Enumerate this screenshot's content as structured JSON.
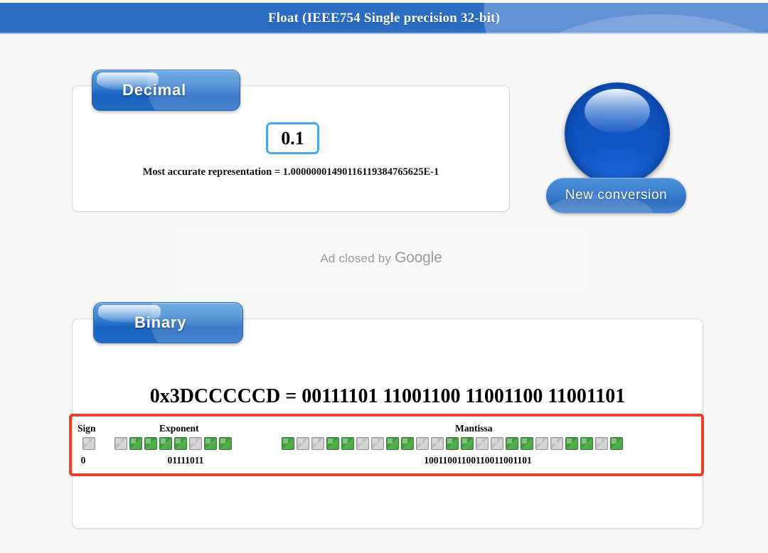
{
  "header": {
    "title": "Float (IEEE754 Single precision 32-bit)"
  },
  "decimal_panel": {
    "tab_label": "Decimal",
    "input_value": "0.1",
    "input_placeholder": "",
    "accurate_representation": "Most accurate representation = 1.00000001490116119384765625E-1"
  },
  "new_conversion_button": {
    "label": "New conversion"
  },
  "ad": {
    "text": "Ad closed by ",
    "brand": "Google"
  },
  "binary_panel": {
    "tab_label": "Binary",
    "hex_line": "0x3DCCCCCD = 00111101 11001100 11001100 11001101",
    "hex_value": "0x3DCCCCCD",
    "binary_groups": [
      "00111101",
      "11001100",
      "11001100",
      "11001101"
    ],
    "fields": {
      "sign": {
        "label": "Sign",
        "bits": "0"
      },
      "exponent": {
        "label": "Exponent",
        "bits": "01111011"
      },
      "mantissa": {
        "label": "Mantissa",
        "bits": "10011001100110011001101"
      }
    }
  },
  "colors": {
    "header_blue": "#2c6dc4",
    "tab_blue": "#1a63c0",
    "bit_on_green": "#49a346",
    "bit_off_gray": "#c9c9c9",
    "highlight_red": "#e8412a",
    "input_border_blue": "#4aa7ec",
    "page_background": "#f7f7f7"
  }
}
